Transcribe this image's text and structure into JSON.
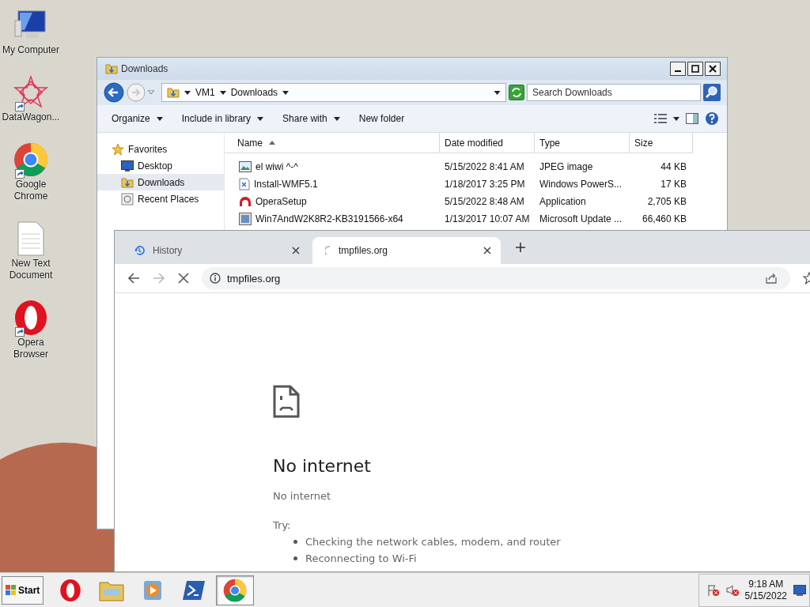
{
  "desktop_icons": [
    {
      "kind": "computer",
      "label": "My Computer",
      "shortcut": false
    },
    {
      "kind": "star",
      "label": "DataWagon...",
      "shortcut": true
    },
    {
      "kind": "chrome",
      "label": "Google Chrome",
      "shortcut": true
    },
    {
      "kind": "text",
      "label": "New Text Document",
      "shortcut": false
    },
    {
      "kind": "opera",
      "label": "Opera Browser",
      "shortcut": true
    }
  ],
  "explorer": {
    "title": "Downloads",
    "breadcrumb": [
      "VM1",
      "Downloads"
    ],
    "search": {
      "placeholder": "Search Downloads"
    },
    "toolbar": [
      {
        "label": "Organize",
        "dropdown": true
      },
      {
        "label": "Include in library",
        "dropdown": true
      },
      {
        "label": "Share with",
        "dropdown": true
      },
      {
        "label": "New folder",
        "dropdown": false
      }
    ],
    "nav": [
      {
        "kind": "star",
        "label": "Favorites",
        "selected": false
      },
      {
        "kind": "desktop",
        "label": "Desktop",
        "selected": false
      },
      {
        "kind": "folder",
        "label": "Downloads",
        "selected": true
      },
      {
        "kind": "recent",
        "label": "Recent Places",
        "selected": false
      }
    ],
    "columns": [
      {
        "label": "Name",
        "sorted": true
      },
      {
        "label": "Date modified",
        "sorted": false
      },
      {
        "label": "Type",
        "sorted": false
      },
      {
        "label": "Size",
        "sorted": false
      }
    ],
    "files": [
      {
        "kind": "image",
        "name": "el wiwi ^-^",
        "date": "5/15/2022 8:41 AM",
        "type": "JPEG image",
        "size": "44 KB"
      },
      {
        "kind": "script",
        "name": "Install-WMF5.1",
        "date": "1/18/2017 3:25 PM",
        "type": "Windows PowerS...",
        "size": "17 KB"
      },
      {
        "kind": "opera",
        "name": "OperaSetup",
        "date": "5/15/2022 8:48 AM",
        "type": "Application",
        "size": "2,705 KB"
      },
      {
        "kind": "update",
        "name": "Win7AndW2K8R2-KB3191566-x64",
        "date": "1/13/2017 10:07 AM",
        "type": "Microsoft Update ...",
        "size": "66,460 KB"
      }
    ]
  },
  "browser": {
    "tabs": [
      {
        "kind": "history",
        "label": "History",
        "selected": false
      },
      {
        "kind": "loading",
        "label": "tmpfiles.org",
        "selected": true
      }
    ],
    "nav_buttons": [
      {
        "kind": "back",
        "disabled": false
      },
      {
        "kind": "forward",
        "disabled": true
      },
      {
        "kind": "stop",
        "disabled": false
      }
    ],
    "address": "tmpfiles.org",
    "error": {
      "title": "No internet",
      "message": "No internet",
      "try_label": "Try:",
      "suggestions": [
        "Checking the network cables, modem, and router",
        "Reconnecting to Wi-Fi"
      ]
    }
  },
  "taskbar": {
    "start": "Start",
    "apps": [
      {
        "kind": "opera",
        "selected": false
      },
      {
        "kind": "explorer",
        "selected": false
      },
      {
        "kind": "media",
        "selected": false
      },
      {
        "kind": "powershell",
        "selected": false
      },
      {
        "kind": "chrome",
        "selected": true
      }
    ],
    "clock": {
      "time": "9:18 AM",
      "date": "5/15/2022"
    }
  }
}
